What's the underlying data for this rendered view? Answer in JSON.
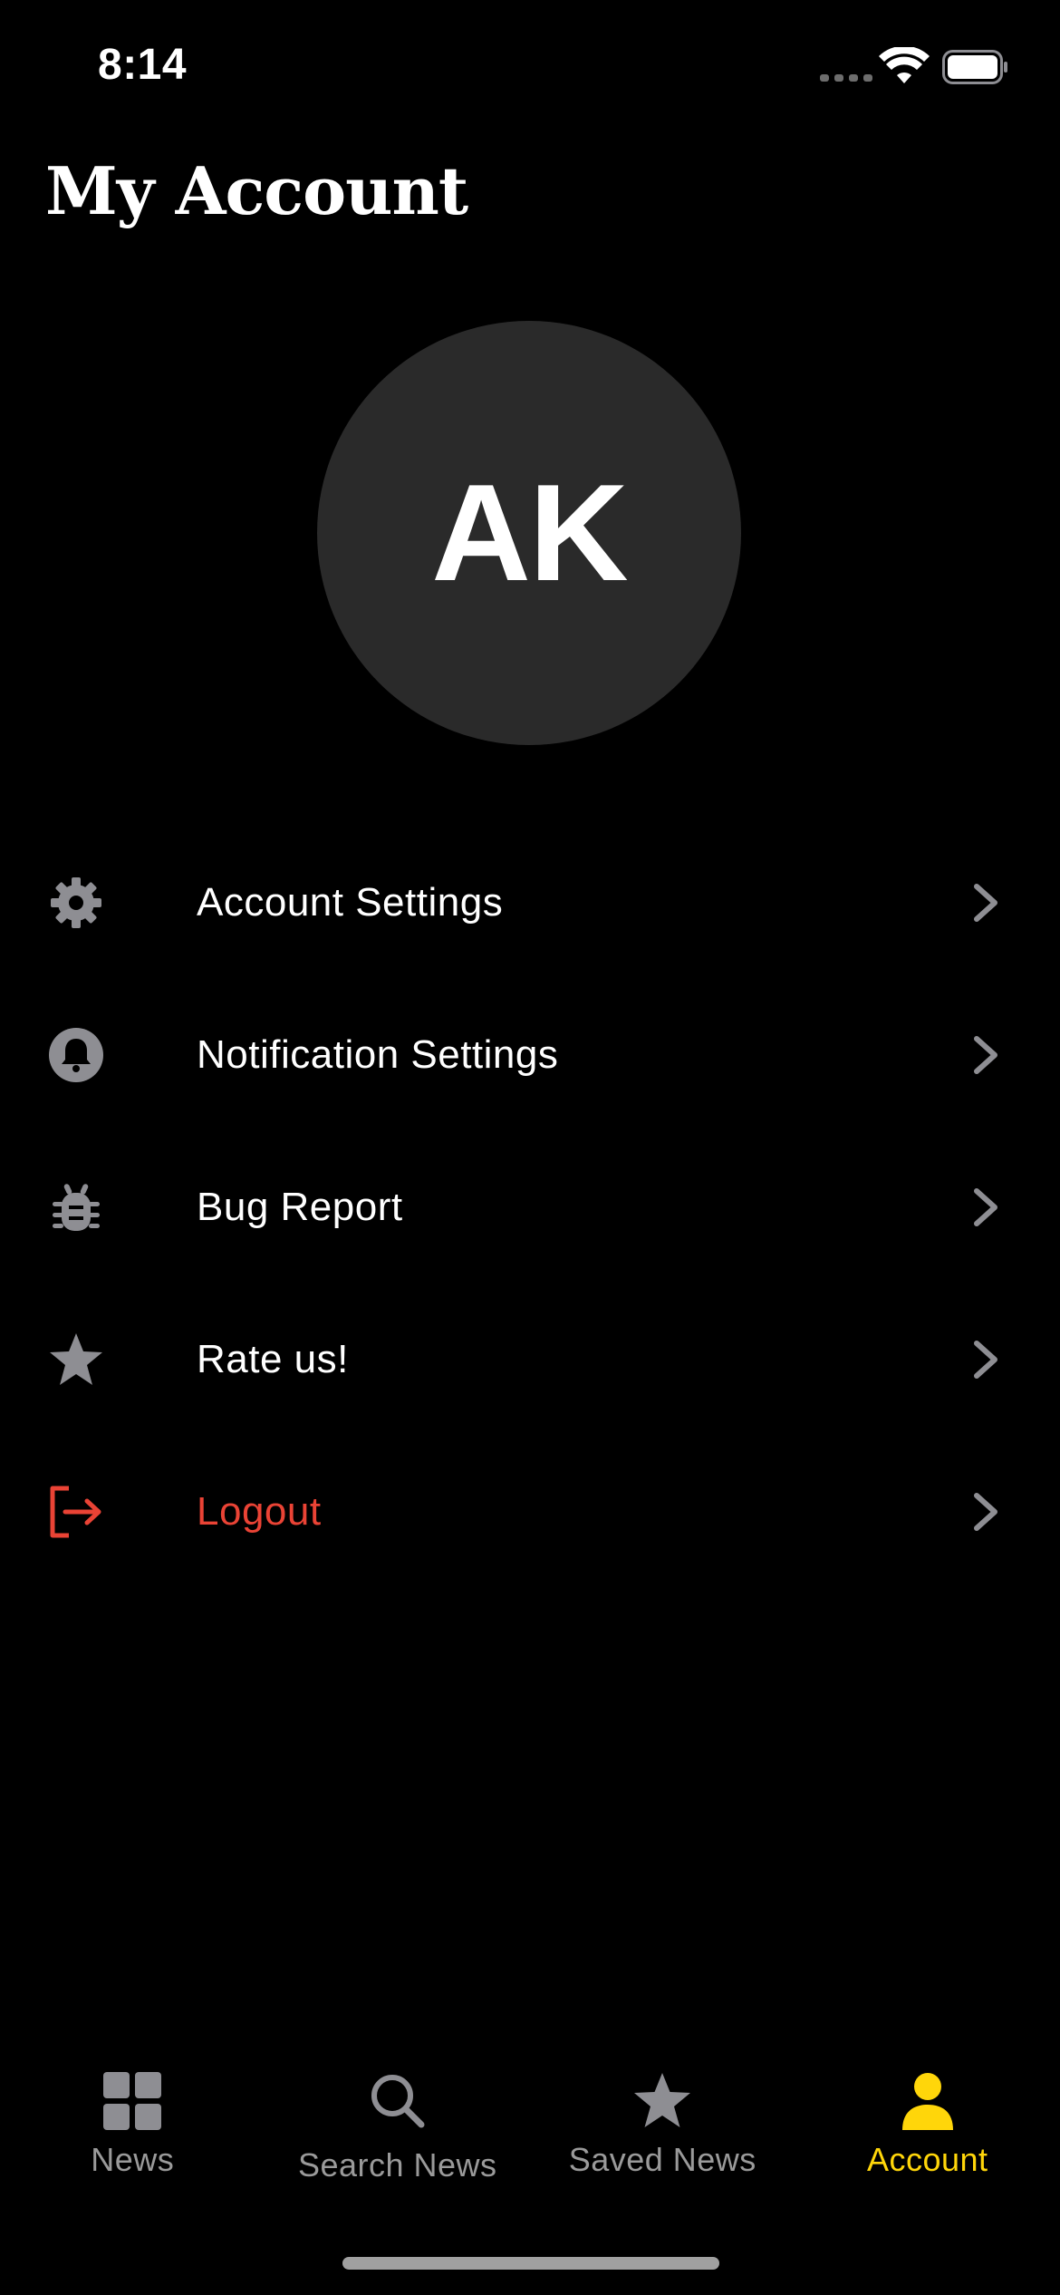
{
  "status_bar": {
    "time": "8:14"
  },
  "header": {
    "title": "My Account"
  },
  "profile": {
    "initials": "AK"
  },
  "menu": {
    "items": [
      {
        "label": "Account Settings",
        "icon": "gear-icon"
      },
      {
        "label": "Notification Settings",
        "icon": "bell-icon"
      },
      {
        "label": "Bug Report",
        "icon": "bug-icon"
      },
      {
        "label": "Rate us!",
        "icon": "star-icon"
      },
      {
        "label": "Logout",
        "icon": "logout-icon"
      }
    ]
  },
  "tab_bar": {
    "tabs": [
      {
        "label": "News",
        "icon": "grid-icon",
        "active": false
      },
      {
        "label": "Search News",
        "icon": "search-icon",
        "active": false
      },
      {
        "label": "Saved News",
        "icon": "star-icon",
        "active": false
      },
      {
        "label": "Account",
        "icon": "person-icon",
        "active": true
      }
    ]
  },
  "colors": {
    "background": "#000000",
    "avatar_bg": "#2a2a2a",
    "icon_gray": "#8e8e93",
    "danger": "#ea4335",
    "accent": "#ffd60a",
    "inactive_tab": "#9a9a9a"
  }
}
